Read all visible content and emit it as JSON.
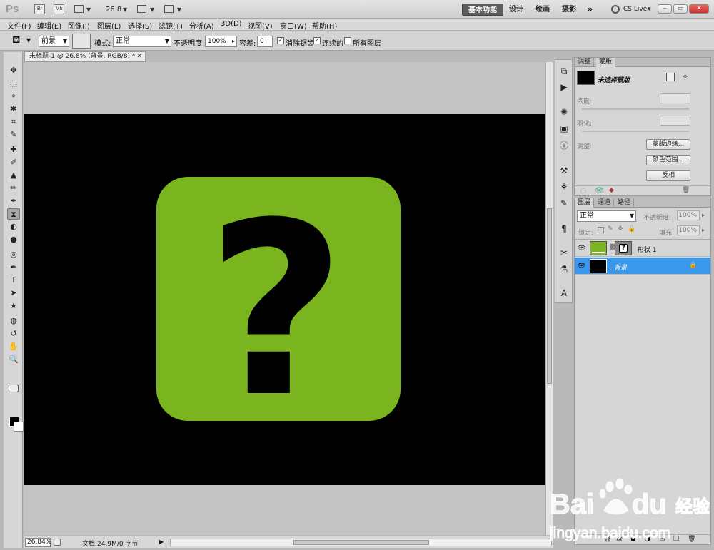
{
  "appbar": {
    "logo": "Ps",
    "bridge_label": "Br",
    "minibridge_label": "Mb",
    "zoom": "26.8",
    "workspaces": [
      "基本功能",
      "设计",
      "绘画",
      "摄影"
    ],
    "more": "»",
    "cs_live": "CS Live",
    "cs_live_caret": "▾",
    "window_buttons": [
      "‒",
      "▭",
      "✕"
    ]
  },
  "menu": [
    "文件(F)",
    "编辑(E)",
    "图像(I)",
    "图层(L)",
    "选择(S)",
    "滤镜(T)",
    "分析(A)",
    "3D(D)",
    "视图(V)",
    "窗口(W)",
    "帮助(H)"
  ],
  "options": {
    "fill_source": "前景",
    "mode_label": "模式:",
    "mode_value": "正常",
    "opacity_label": "不透明度:",
    "opacity_value": "100%",
    "tolerance_label": "容差:",
    "tolerance_value": "0",
    "antialias_label": "消除锯齿",
    "contiguous_label": "连续的",
    "all_layers_label": "所有图层",
    "checked_mark": "✓"
  },
  "tools": [
    "✥",
    "⬚",
    "⌖",
    "✱",
    "⌗",
    "✎",
    "✚",
    "✐",
    "▲",
    "✏",
    "✒",
    "⧗",
    "◐",
    "●",
    "◎",
    "✒",
    "T",
    "➤",
    "★",
    "◍",
    "↺",
    "✋",
    "🔍"
  ],
  "document": {
    "tab_title": "未标题-1 @ 26.8% (背景, RGB/8) *",
    "close": "✕",
    "status_zoom": "26.84%",
    "status_info": "文档:24.9M/0 字节"
  },
  "artwork": {
    "bg_color": "#000000",
    "shape_color": "#7ab520",
    "glyph_color": "#000000",
    "glyph": "?"
  },
  "masks_panel": {
    "tabs": [
      "调整",
      "蒙版"
    ],
    "no_mask": "未选择蒙版",
    "density_label": "浓度:",
    "feather_label": "羽化:",
    "refine_label": "调整:",
    "edge_button": "蒙版边缘...",
    "color_range_button": "颜色范围...",
    "invert_button": "反相"
  },
  "layers_panel": {
    "tabs": [
      "图层",
      "通道",
      "路径"
    ],
    "blend_mode": "正常",
    "opacity_label": "不透明度:",
    "opacity_value": "100%",
    "lock_label": "锁定:",
    "fill_label": "填充:",
    "fill_value": "100%",
    "layers": [
      {
        "name": "形状 1"
      },
      {
        "name": "背景"
      }
    ]
  },
  "watermark": {
    "brand": "Bai",
    "brand2": "du",
    "cn": "经验",
    "url": "jingyan.baidu.com"
  }
}
